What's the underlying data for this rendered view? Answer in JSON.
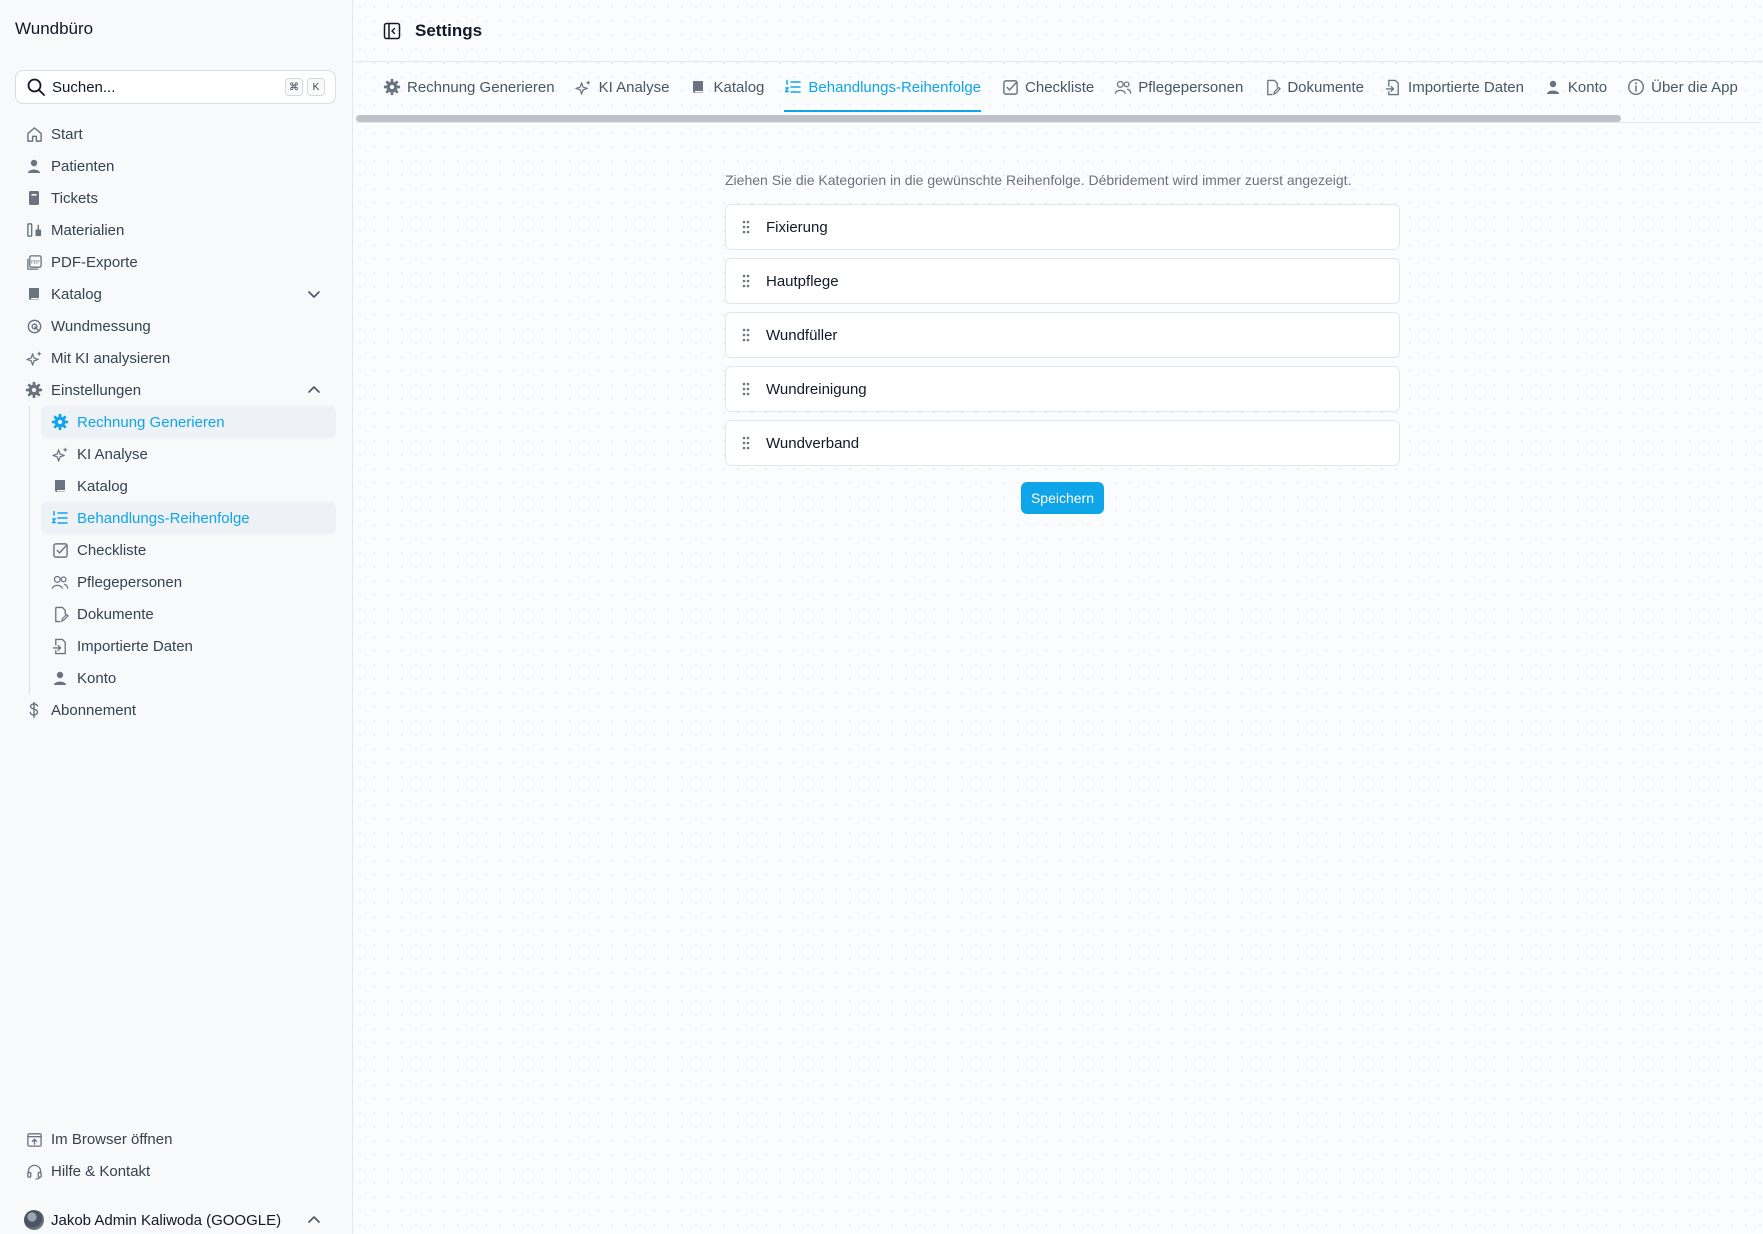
{
  "colors": {
    "accent": "#0ea5e9",
    "text": "#374151",
    "muted": "#6b7280"
  },
  "sidebar": {
    "brand": "Wundbüro",
    "search": {
      "placeholder": "Suchen...",
      "shortcut_mod": "⌘",
      "shortcut_key": "K"
    },
    "items": [
      {
        "label": "Start",
        "icon": "home-icon"
      },
      {
        "label": "Patienten",
        "icon": "user-icon"
      },
      {
        "label": "Tickets",
        "icon": "ticket-icon"
      },
      {
        "label": "Materialien",
        "icon": "materials-icon"
      },
      {
        "label": "PDF-Exporte",
        "icon": "pdf-icon"
      },
      {
        "label": "Katalog",
        "icon": "book-icon"
      },
      {
        "label": "Wundmessung",
        "icon": "measure-icon"
      },
      {
        "label": "Mit KI analysieren",
        "icon": "sparkles-icon"
      },
      {
        "label": "Einstellungen",
        "icon": "gear-icon"
      }
    ],
    "settings_sub": [
      {
        "label": "Rechnung Generieren",
        "icon": "gear-icon"
      },
      {
        "label": "KI Analyse",
        "icon": "sparkles-icon"
      },
      {
        "label": "Katalog",
        "icon": "book-icon"
      },
      {
        "label": "Behandlungs-Reihenfolge",
        "icon": "ordered-list-icon"
      },
      {
        "label": "Checkliste",
        "icon": "checkbox-icon"
      },
      {
        "label": "Pflegepersonen",
        "icon": "users-icon"
      },
      {
        "label": "Dokumente",
        "icon": "document-edit-icon"
      },
      {
        "label": "Importierte Daten",
        "icon": "file-import-icon"
      },
      {
        "label": "Konto",
        "icon": "user-icon"
      }
    ],
    "abonnement": "Abonnement",
    "footer": [
      {
        "label": "Im Browser öffnen",
        "icon": "external-icon"
      },
      {
        "label": "Hilfe & Kontakt",
        "icon": "headset-icon"
      }
    ],
    "user": "Jakob Admin Kaliwoda (GOOGLE)"
  },
  "header": {
    "title": "Settings"
  },
  "tabs": [
    {
      "label": "Rechnung Generieren",
      "icon": "gear-icon"
    },
    {
      "label": "KI Analyse",
      "icon": "sparkles-icon"
    },
    {
      "label": "Katalog",
      "icon": "book-icon"
    },
    {
      "label": "Behandlungs-Reihenfolge",
      "icon": "ordered-list-icon",
      "active": true
    },
    {
      "label": "Checkliste",
      "icon": "checkbox-icon"
    },
    {
      "label": "Pflegepersonen",
      "icon": "users-icon"
    },
    {
      "label": "Dokumente",
      "icon": "document-edit-icon"
    },
    {
      "label": "Importierte Daten",
      "icon": "file-import-icon"
    },
    {
      "label": "Konto",
      "icon": "user-icon"
    },
    {
      "label": "Über die App",
      "icon": "info-icon"
    }
  ],
  "main": {
    "description": "Ziehen Sie die Kategorien in die gewünschte Reihenfolge. Débridement wird immer zuerst angezeigt.",
    "categories": [
      "Fixierung",
      "Hautpflege",
      "Wundfüller",
      "Wundreinigung",
      "Wundverband"
    ],
    "save_label": "Speichern"
  }
}
